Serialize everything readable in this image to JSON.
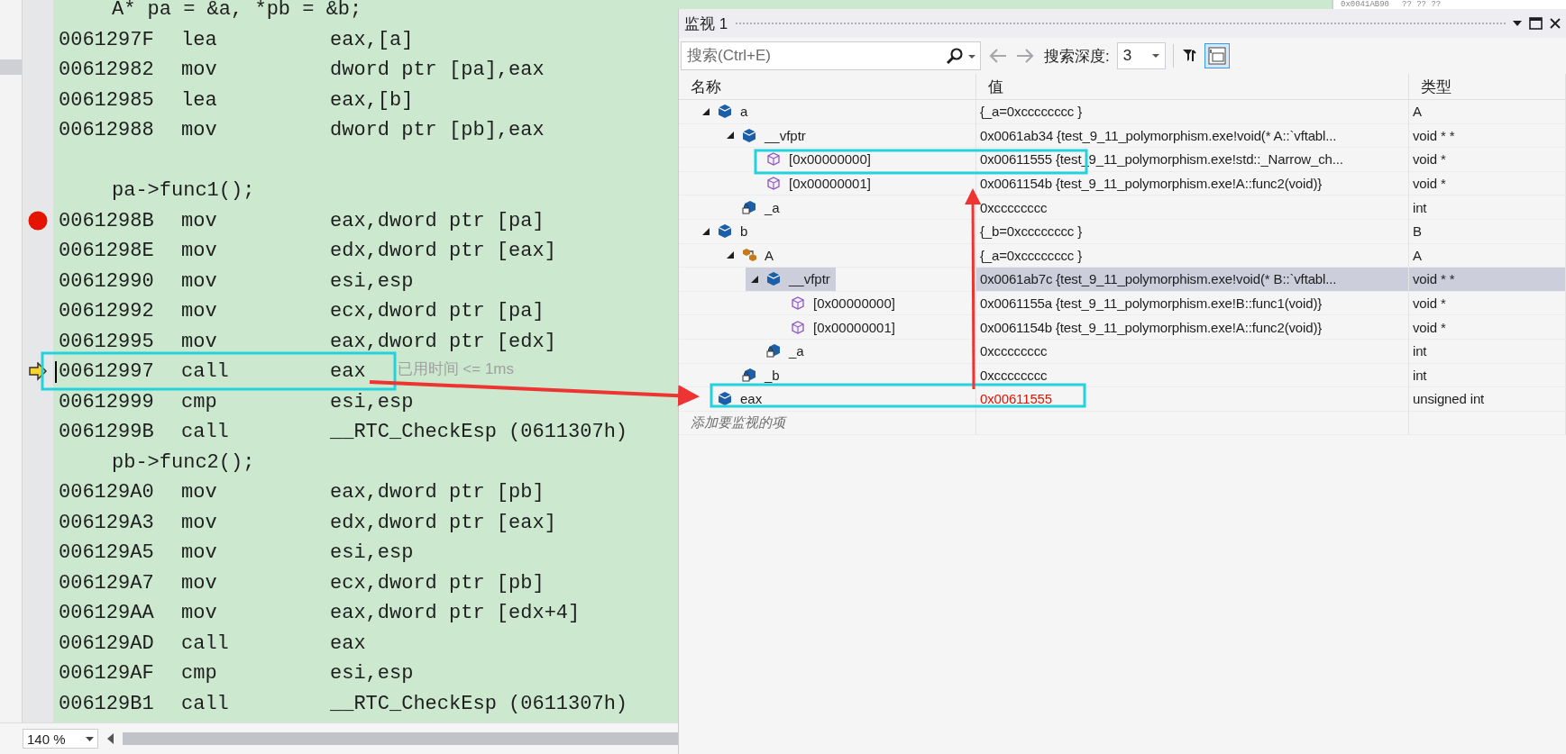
{
  "editor": {
    "lines": [
      {
        "kind": "source",
        "text": "A* pa = &a, *pb = &b;"
      },
      {
        "kind": "asm",
        "address": "0061297F",
        "mnemonic": "lea",
        "operands": "eax,[a]",
        "breakpoint": false,
        "current": false
      },
      {
        "kind": "asm",
        "address": "00612982",
        "mnemonic": "mov",
        "operands": "dword ptr [pa],eax",
        "breakpoint": false,
        "current": false
      },
      {
        "kind": "asm",
        "address": "00612985",
        "mnemonic": "lea",
        "operands": "eax,[b]",
        "breakpoint": false,
        "current": false
      },
      {
        "kind": "asm",
        "address": "00612988",
        "mnemonic": "mov",
        "operands": "dword ptr [pb],eax",
        "breakpoint": false,
        "current": false
      },
      {
        "kind": "blank"
      },
      {
        "kind": "source",
        "text": "pa->func1();"
      },
      {
        "kind": "asm",
        "address": "0061298B",
        "mnemonic": "mov",
        "operands": "eax,dword ptr [pa]",
        "breakpoint": true,
        "current": false
      },
      {
        "kind": "asm",
        "address": "0061298E",
        "mnemonic": "mov",
        "operands": "edx,dword ptr [eax]",
        "breakpoint": false,
        "current": false
      },
      {
        "kind": "asm",
        "address": "00612990",
        "mnemonic": "mov",
        "operands": "esi,esp",
        "breakpoint": false,
        "current": false
      },
      {
        "kind": "asm",
        "address": "00612992",
        "mnemonic": "mov",
        "operands": "ecx,dword ptr [pa]",
        "breakpoint": false,
        "current": false
      },
      {
        "kind": "asm",
        "address": "00612995",
        "mnemonic": "mov",
        "operands": "eax,dword ptr [edx]",
        "breakpoint": false,
        "current": false
      },
      {
        "kind": "asm",
        "address": "00612997",
        "mnemonic": "call",
        "operands": "eax",
        "breakpoint": false,
        "current": true,
        "elapsed": "已用时间 <= 1ms"
      },
      {
        "kind": "asm",
        "address": "00612999",
        "mnemonic": "cmp",
        "operands": "esi,esp",
        "breakpoint": false,
        "current": false
      },
      {
        "kind": "asm",
        "address": "0061299B",
        "mnemonic": "call",
        "operands": "__RTC_CheckEsp (0611307h)",
        "breakpoint": false,
        "current": false
      },
      {
        "kind": "source",
        "text": "pb->func2();"
      },
      {
        "kind": "asm",
        "address": "006129A0",
        "mnemonic": "mov",
        "operands": "eax,dword ptr [pb]",
        "breakpoint": false,
        "current": false
      },
      {
        "kind": "asm",
        "address": "006129A3",
        "mnemonic": "mov",
        "operands": "edx,dword ptr [eax]",
        "breakpoint": false,
        "current": false
      },
      {
        "kind": "asm",
        "address": "006129A5",
        "mnemonic": "mov",
        "operands": "esi,esp",
        "breakpoint": false,
        "current": false
      },
      {
        "kind": "asm",
        "address": "006129A7",
        "mnemonic": "mov",
        "operands": "ecx,dword ptr [pb]",
        "breakpoint": false,
        "current": false
      },
      {
        "kind": "asm",
        "address": "006129AA",
        "mnemonic": "mov",
        "operands": "eax,dword ptr [edx+4]",
        "breakpoint": false,
        "current": false
      },
      {
        "kind": "asm",
        "address": "006129AD",
        "mnemonic": "call",
        "operands": "eax",
        "breakpoint": false,
        "current": false
      },
      {
        "kind": "asm",
        "address": "006129AF",
        "mnemonic": "cmp",
        "operands": "esi,esp",
        "breakpoint": false,
        "current": false
      },
      {
        "kind": "asm",
        "address": "006129B1",
        "mnemonic": "call",
        "operands": "__RTC_CheckEsp (0611307h)",
        "breakpoint": false,
        "current": false
      }
    ],
    "zoom": "140 %"
  },
  "memory_window": {
    "address": "0x0041AB90",
    "bytes": "?? ?? ??"
  },
  "watch": {
    "title": "监视 1",
    "search": {
      "placeholder": "搜索(Ctrl+E)"
    },
    "depth_label": "搜索深度:",
    "depth": "3",
    "columns": [
      "名称",
      "值",
      "类型"
    ],
    "rows": [
      {
        "name": "a",
        "value": "{_a=0xcccccccc }",
        "type": "A",
        "kind": "object",
        "expanded": true,
        "selected": false,
        "changed": false,
        "children": [
          {
            "name": "__vfptr",
            "value": "0x0061ab34 {test_9_11_polymorphism.exe!void(* A::`vftabl...",
            "type": "void * *",
            "kind": "object",
            "expanded": true,
            "selected": false,
            "changed": false,
            "children": [
              {
                "name": "[0x00000000]",
                "value": "0x00611555 {test_9_11_polymorphism.exe!std::_Narrow_ch...",
                "type": "void *",
                "kind": "function",
                "selected": false,
                "changed": false
              },
              {
                "name": "[0x00000001]",
                "value": "0x0061154b {test_9_11_polymorphism.exe!A::func2(void)}",
                "type": "void *",
                "kind": "function",
                "selected": false,
                "changed": false
              }
            ]
          },
          {
            "name": "_a",
            "value": "0xcccccccc",
            "type": "int",
            "kind": "private",
            "selected": false,
            "changed": false
          }
        ]
      },
      {
        "name": "b",
        "value": "{_b=0xcccccccc }",
        "type": "B",
        "kind": "object",
        "expanded": true,
        "selected": false,
        "changed": false,
        "children": [
          {
            "name": "A",
            "value": "{_a=0xcccccccc }",
            "type": "A",
            "kind": "base",
            "expanded": true,
            "selected": false,
            "changed": false,
            "children": [
              {
                "name": "__vfptr",
                "value": "0x0061ab7c {test_9_11_polymorphism.exe!void(* B::`vftabl...",
                "type": "void * *",
                "kind": "object",
                "expanded": true,
                "selected": true,
                "changed": false,
                "children": [
                  {
                    "name": "[0x00000000]",
                    "value": "0x0061155a {test_9_11_polymorphism.exe!B::func1(void)}",
                    "type": "void *",
                    "kind": "function",
                    "selected": false,
                    "changed": false
                  },
                  {
                    "name": "[0x00000001]",
                    "value": "0x0061154b {test_9_11_polymorphism.exe!A::func2(void)}",
                    "type": "void *",
                    "kind": "function",
                    "selected": false,
                    "changed": false
                  }
                ]
              },
              {
                "name": "_a",
                "value": "0xcccccccc",
                "type": "int",
                "kind": "private",
                "selected": false,
                "changed": false
              }
            ]
          },
          {
            "name": "_b",
            "value": "0xcccccccc",
            "type": "int",
            "kind": "private",
            "selected": false,
            "changed": false
          }
        ]
      },
      {
        "name": "eax",
        "value": "0x00611555",
        "type": "unsigned int",
        "kind": "object",
        "selected": false,
        "changed": true
      }
    ],
    "add_item_placeholder": "添加要监视的项"
  }
}
